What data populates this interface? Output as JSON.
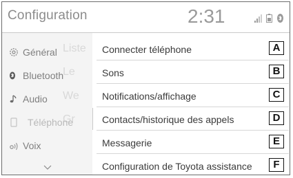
{
  "header": {
    "title": "Configuration",
    "clock": "2:31",
    "status_icons": [
      "signal-icon",
      "battery-icon",
      "bluetooth-icon"
    ]
  },
  "sidebar": {
    "items": [
      {
        "label": "Général",
        "icon": "gear-icon"
      },
      {
        "label": "Bluetooth",
        "icon": "bluetooth-icon"
      },
      {
        "label": "Audio",
        "icon": "music-note-icon"
      },
      {
        "label": "Téléphone",
        "icon": "phone-icon",
        "active": true
      },
      {
        "label": "Voix",
        "icon": "voice-icon"
      }
    ],
    "more_icon": "chevron-down-icon"
  },
  "menu": {
    "items": [
      {
        "label": "Connecter téléphone",
        "callout": "A"
      },
      {
        "label": "Sons",
        "callout": "B"
      },
      {
        "label": "Notifications/affichage",
        "callout": "C"
      },
      {
        "label": "Contacts/historique des appels",
        "callout": "D"
      },
      {
        "label": "Messagerie",
        "callout": "E"
      },
      {
        "label": "Configuration de Toyota assistance",
        "callout": "F"
      }
    ]
  },
  "colors": {
    "title_gray": "#8c8c8c",
    "sidebar_bg": "#f4f4f4",
    "menu_text": "#3a3a3a",
    "callout_border": "#111111"
  }
}
